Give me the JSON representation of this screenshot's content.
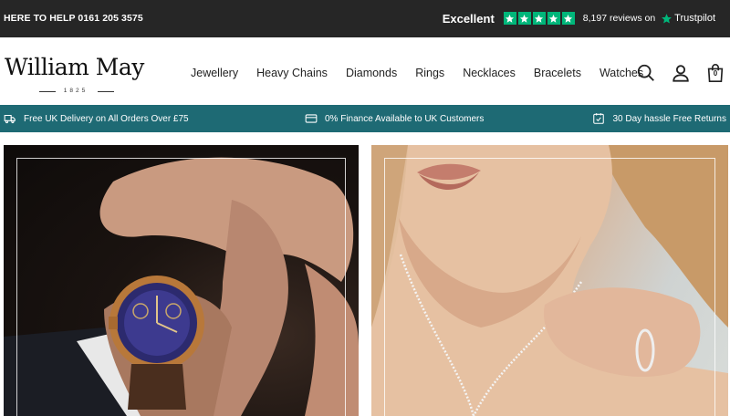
{
  "topbar": {
    "help_text": "HERE TO HELP 0161 205 3575",
    "trustpilot": {
      "rating_word": "Excellent",
      "stars": 5,
      "reviews_text": "8,197 reviews on",
      "brand": "Trustpilot"
    }
  },
  "header": {
    "logo": {
      "brand": "William May",
      "year": "1825"
    },
    "nav": [
      {
        "label": "Jewellery"
      },
      {
        "label": "Heavy Chains"
      },
      {
        "label": "Diamonds"
      },
      {
        "label": "Rings"
      },
      {
        "label": "Necklaces"
      },
      {
        "label": "Bracelets"
      },
      {
        "label": "Watches"
      }
    ],
    "icons": {
      "search": "search-icon",
      "account": "user-icon",
      "bag": "shopping-bag-icon"
    },
    "bag_count": "0"
  },
  "usp": {
    "delivery": "Free UK Delivery on All Orders Over £75",
    "finance": "0% Finance Available to UK Customers",
    "returns": "30 Day hassle Free Returns"
  },
  "colors": {
    "topbar_bg": "#262626",
    "usp_bg": "#1e6a74",
    "trustpilot_green": "#00b67a"
  },
  "hero": {
    "left_image": "watch-on-wrist",
    "right_image": "diamond-necklace-model"
  }
}
